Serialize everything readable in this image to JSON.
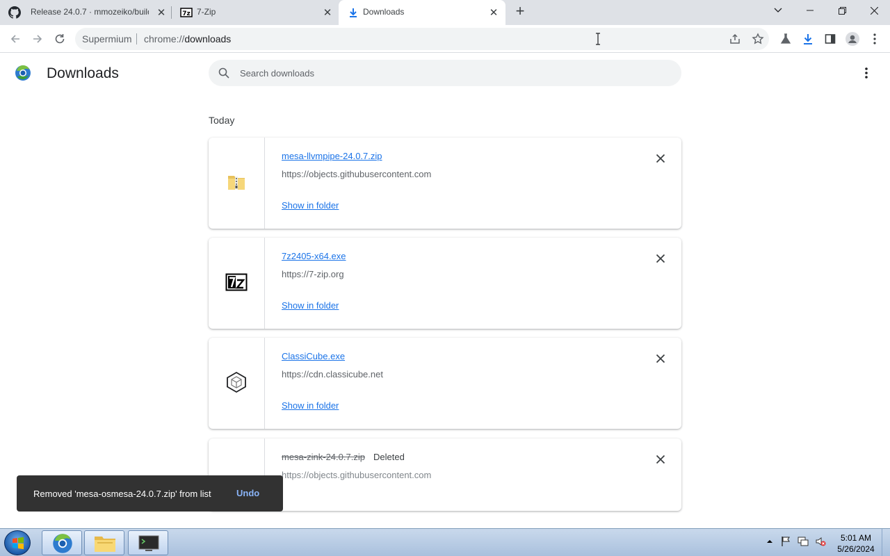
{
  "tabs": [
    {
      "title": "Release 24.0.7 · mmozeiko/build",
      "icon": "github-icon"
    },
    {
      "title": "7-Zip",
      "icon": "7zip-icon"
    },
    {
      "title": "Downloads",
      "icon": "download-icon",
      "active": true
    }
  ],
  "toolbar": {
    "site_name": "Supermium",
    "url_scheme": "chrome://",
    "url_host": "downloads"
  },
  "page": {
    "title": "Downloads",
    "search_placeholder": "Search downloads",
    "section_label": "Today"
  },
  "downloads": [
    {
      "filename": "mesa-llvmpipe-24.0.7.zip",
      "url": "https://objects.githubusercontent.com",
      "action": "Show in folder",
      "icon": "zip-folder-icon"
    },
    {
      "filename": "7z2405-x64.exe",
      "url": "https://7-zip.org",
      "action": "Show in folder",
      "icon": "7zip-icon"
    },
    {
      "filename": "ClassiCube.exe",
      "url": "https://cdn.classicube.net",
      "action": "Show in folder",
      "icon": "cube-icon"
    },
    {
      "filename": "mesa-zink-24.0.7.zip",
      "url": "https://objects.githubusercontent.com",
      "status": "Deleted",
      "icon": "zip-folder-icon"
    }
  ],
  "toast": {
    "message": "Removed 'mesa-osmesa-24.0.7.zip' from list",
    "action": "Undo"
  },
  "taskbar": {
    "time": "5:01 AM",
    "date": "5/26/2024"
  },
  "colors": {
    "link": "#1a73e8",
    "tabstrip": "#dee1e6",
    "toast_bg": "#323232",
    "toast_action": "#8ab4f8"
  }
}
